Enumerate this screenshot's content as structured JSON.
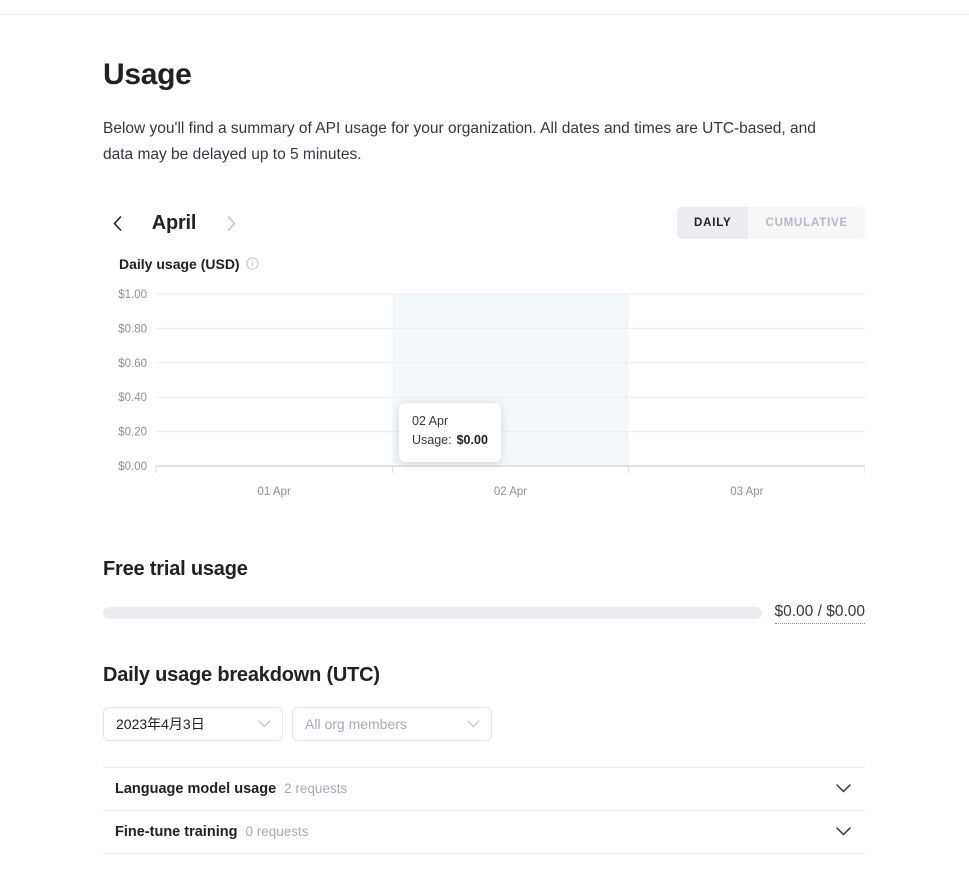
{
  "page": {
    "title": "Usage",
    "description": "Below you'll find a summary of API usage for your organization. All dates and times are UTC-based, and data may be delayed up to 5 minutes."
  },
  "chart_controls": {
    "prev_icon": "chevron-left-icon",
    "next_icon": "chevron-right-icon",
    "month": "April",
    "daily_label": "DAILY",
    "cumulative_label": "CUMULATIVE",
    "active_view": "DAILY"
  },
  "chart_heading": {
    "title": "Daily usage (USD)",
    "info_icon": "info-circle-icon"
  },
  "chart_data": {
    "type": "bar",
    "title": "Daily usage (USD)",
    "xlabel": "",
    "ylabel": "",
    "categories": [
      "01 Apr",
      "02 Apr",
      "03 Apr"
    ],
    "values": [
      0.0,
      0.0,
      0.0
    ],
    "ylim": [
      0,
      1.0
    ],
    "ytick_values": [
      1.0,
      0.8,
      0.6,
      0.4,
      0.2,
      0.0
    ],
    "ytick_labels": [
      "$1.00",
      "$0.80",
      "$0.60",
      "$0.40",
      "$0.20",
      "$0.00"
    ],
    "xtick_labels": [
      "01 Apr",
      "02 Apr",
      "03 Apr"
    ],
    "grid": true,
    "legend": null,
    "hovered_category": "02 Apr",
    "currency": "USD",
    "colors": {
      "grid": "#ececf1",
      "axis": "#d9d9e3",
      "hover_band": "#f4f7fa",
      "tick_text": "#8e8ea0"
    }
  },
  "tooltip": {
    "date": "02 Apr",
    "usage_label": "Usage:",
    "usage_value": "$0.00"
  },
  "free_trial": {
    "title": "Free trial usage",
    "amount": "$0.00 / $0.00",
    "progress_percent": 0
  },
  "breakdown": {
    "title": "Daily usage breakdown (UTC)",
    "date_select": {
      "value": "2023年4月3日",
      "chevron_icon": "chevron-down-icon"
    },
    "members_select": {
      "placeholder": "All org members",
      "chevron_icon": "chevron-down-icon"
    },
    "rows": [
      {
        "label": "Language model usage",
        "count": "2 requests",
        "chevron_icon": "chevron-down-icon"
      },
      {
        "label": "Fine-tune training",
        "count": "0 requests",
        "chevron_icon": "chevron-down-icon"
      }
    ]
  }
}
